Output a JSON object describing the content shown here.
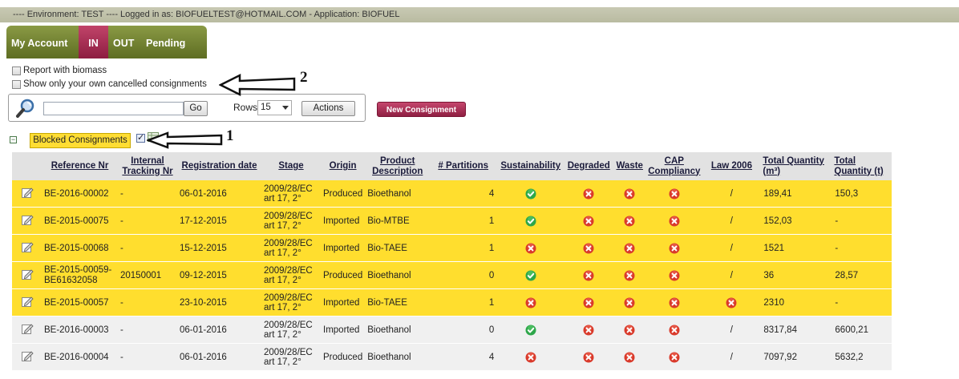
{
  "env_bar": "---- Environment: TEST ---- Logged in as: BIOFUELTEST@HOTMAIL.COM - Application: BIOFUEL",
  "tabs": [
    {
      "label": "My Account",
      "active": false
    },
    {
      "label": "IN",
      "active": true
    },
    {
      "label": "OUT",
      "active": false
    },
    {
      "label": "Pending",
      "active": false
    }
  ],
  "options": {
    "report_biomass": "Report with biomass",
    "own_cancelled": "Show only your own cancelled consignments"
  },
  "search": {
    "value": "",
    "go_label": "Go",
    "rows_label": "Rows",
    "rows_value": "15",
    "actions_label": "Actions"
  },
  "new_consignment_label": "New Consignment",
  "blocked_label": "Blocked Consignments",
  "annotations": {
    "arrow1": "1",
    "arrow2": "2"
  },
  "colors": {
    "blocked_row": "#ffde2e",
    "normal_row": "#f0f0f0",
    "accent": "#a8284f",
    "tab_green": "#6e7d2c"
  },
  "table": {
    "headers": [
      {
        "key": "edit",
        "label": ""
      },
      {
        "key": "ref",
        "label": "Reference Nr"
      },
      {
        "key": "internal",
        "label": "Internal Tracking Nr"
      },
      {
        "key": "reg",
        "label": "Registration date"
      },
      {
        "key": "stage",
        "label": "Stage"
      },
      {
        "key": "origin",
        "label": "Origin"
      },
      {
        "key": "product",
        "label": "Product Description"
      },
      {
        "key": "partitions",
        "label": "# Partitions"
      },
      {
        "key": "sustain",
        "label": "Sustainability"
      },
      {
        "key": "degraded",
        "label": "Degraded"
      },
      {
        "key": "waste",
        "label": "Waste"
      },
      {
        "key": "cap",
        "label": "CAP Compliancy"
      },
      {
        "key": "law",
        "label": "Law 2006"
      },
      {
        "key": "tq_m3",
        "label": "Total Quantity (m³)"
      },
      {
        "key": "tq_t",
        "label": "Total Quantity (t)"
      }
    ],
    "rows": [
      {
        "blocked": true,
        "ref": "BE-2016-00002",
        "internal": "-",
        "reg": "06-01-2016",
        "stage": "2009/28/EC art 17, 2°",
        "origin": "Produced",
        "product": "Bioethanol",
        "partitions": "4",
        "sustain": "check",
        "degraded": "cross",
        "waste": "cross",
        "cap": "cross",
        "law": "/",
        "tq_m3": "189,41",
        "tq_t": "150,3"
      },
      {
        "blocked": true,
        "ref": "BE-2015-00075",
        "internal": "-",
        "reg": "17-12-2015",
        "stage": "2009/28/EC art 17, 2°",
        "origin": "Imported",
        "product": "Bio-MTBE",
        "partitions": "1",
        "sustain": "check",
        "degraded": "cross",
        "waste": "cross",
        "cap": "cross",
        "law": "/",
        "tq_m3": "152,03",
        "tq_t": "-"
      },
      {
        "blocked": true,
        "ref": "BE-2015-00068",
        "internal": "-",
        "reg": "15-12-2015",
        "stage": "2009/28/EC art 17, 2°",
        "origin": "Imported",
        "product": "Bio-TAEE",
        "partitions": "1",
        "sustain": "cross",
        "degraded": "cross",
        "waste": "cross",
        "cap": "cross",
        "law": "/",
        "tq_m3": "1521",
        "tq_t": "-"
      },
      {
        "blocked": true,
        "ref": "BE-2015-00059-BE61632058",
        "internal": "20150001",
        "reg": "09-12-2015",
        "stage": "2009/28/EC art 17, 2°",
        "origin": "Produced",
        "product": "Bioethanol",
        "partitions": "0",
        "sustain": "check",
        "degraded": "cross",
        "waste": "cross",
        "cap": "cross",
        "law": "/",
        "tq_m3": "36",
        "tq_t": "28,57"
      },
      {
        "blocked": true,
        "ref": "BE-2015-00057",
        "internal": "-",
        "reg": "23-10-2015",
        "stage": "2009/28/EC art 17, 2°",
        "origin": "Imported",
        "product": "Bio-TAEE",
        "partitions": "1",
        "sustain": "cross",
        "degraded": "cross",
        "waste": "cross",
        "cap": "cross",
        "law": "cross",
        "tq_m3": "2310",
        "tq_t": "-"
      },
      {
        "blocked": false,
        "ref": "BE-2016-00003",
        "internal": "-",
        "reg": "06-01-2016",
        "stage": "2009/28/EC art 17, 2°",
        "origin": "Imported",
        "product": "Bioethanol",
        "partitions": "0",
        "sustain": "check",
        "degraded": "cross",
        "waste": "cross",
        "cap": "cross",
        "law": "/",
        "tq_m3": "8317,84",
        "tq_t": "6600,21"
      },
      {
        "blocked": false,
        "ref": "BE-2016-00004",
        "internal": "-",
        "reg": "06-01-2016",
        "stage": "2009/28/EC art 17, 2°",
        "origin": "Produced",
        "product": "Bioethanol",
        "partitions": "4",
        "sustain": "cross",
        "degraded": "cross",
        "waste": "cross",
        "cap": "cross",
        "law": "/",
        "tq_m3": "7097,92",
        "tq_t": "5632,2"
      }
    ]
  }
}
